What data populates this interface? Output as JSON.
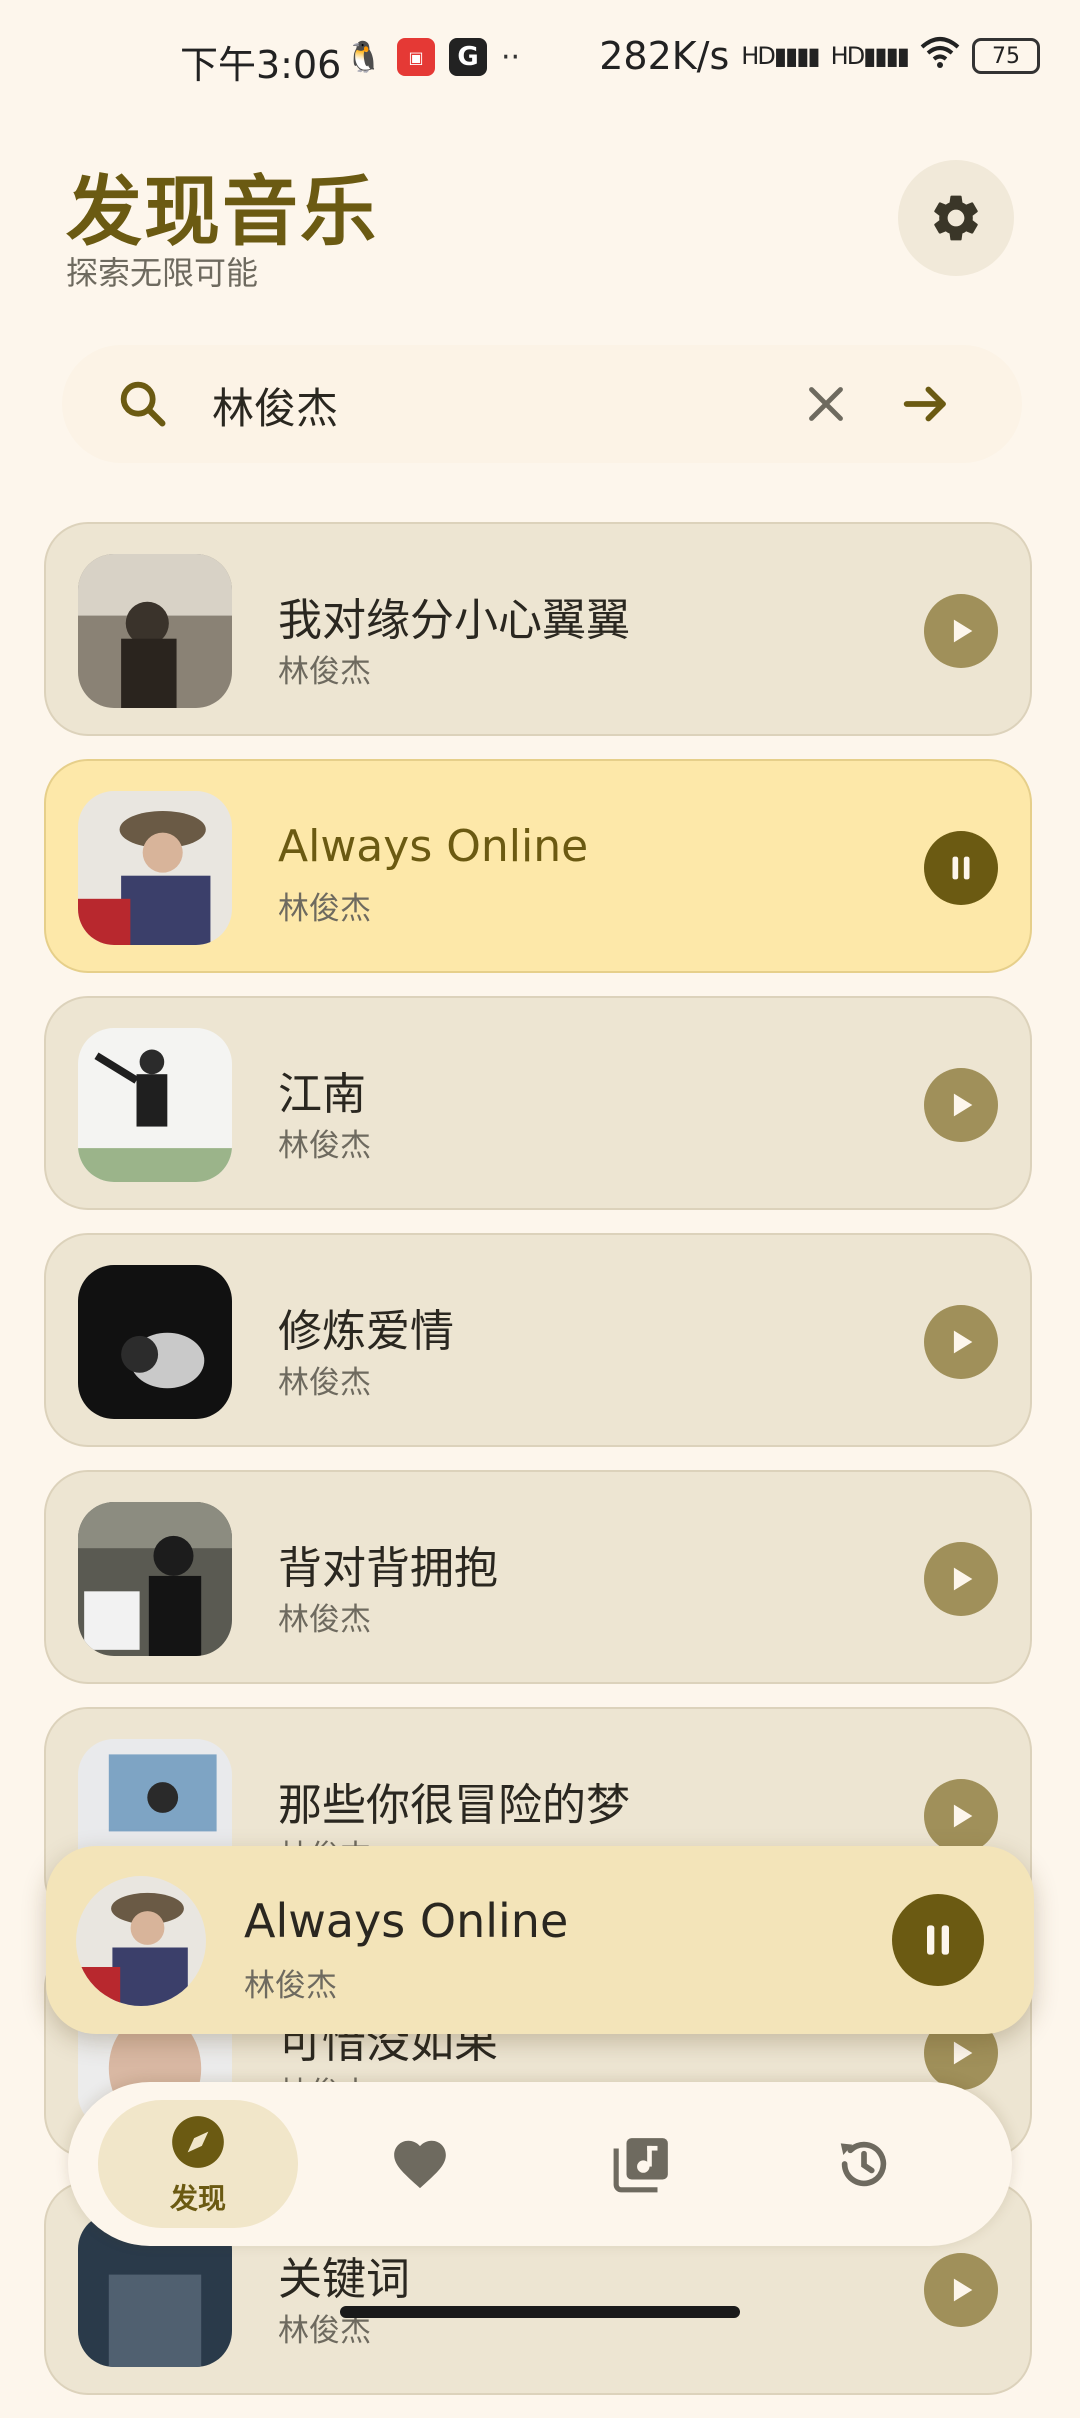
{
  "status_bar": {
    "time": "下午3:06",
    "net_speed": "282K/s",
    "signal1": "HD",
    "signal2": "HD",
    "battery": "75",
    "icons": [
      "qq-icon",
      "news-app-icon",
      "g-app-icon"
    ]
  },
  "header": {
    "title": "发现音乐",
    "subtitle": "探索无限可能",
    "settings_icon": "gear-icon"
  },
  "search": {
    "value": "林俊杰",
    "search_icon": "search-icon",
    "clear_icon": "close-icon",
    "submit_icon": "arrow-right-icon"
  },
  "songs": [
    {
      "title": "我对缘分小心翼翼",
      "artist": "林俊杰",
      "playing": false
    },
    {
      "title": "Always Online",
      "artist": "林俊杰",
      "playing": true
    },
    {
      "title": "江南",
      "artist": "林俊杰",
      "playing": false
    },
    {
      "title": "修炼爱情",
      "artist": "林俊杰",
      "playing": false
    },
    {
      "title": "背对背拥抱",
      "artist": "林俊杰",
      "playing": false
    },
    {
      "title": "那些你很冒险的梦",
      "artist": "林俊杰",
      "playing": false
    },
    {
      "title": "可惜没如果",
      "artist": "林俊杰",
      "playing": false
    },
    {
      "title": "关键词",
      "artist": "林俊杰",
      "playing": false
    }
  ],
  "mini_player": {
    "title": "Always Online",
    "artist": "林俊杰",
    "state_icon": "pause-icon"
  },
  "bottom_nav": {
    "items": [
      {
        "label": "发现",
        "icon": "compass-icon",
        "active": true
      },
      {
        "label": "",
        "icon": "heart-icon",
        "active": false
      },
      {
        "label": "",
        "icon": "music-library-icon",
        "active": false
      },
      {
        "label": "",
        "icon": "history-icon",
        "active": false
      }
    ]
  },
  "colors": {
    "background": "#fdf6ec",
    "accent": "#6b5a12",
    "card": "#ede5d2",
    "card_playing": "#fde8a9",
    "play_button": "#a0905a"
  }
}
